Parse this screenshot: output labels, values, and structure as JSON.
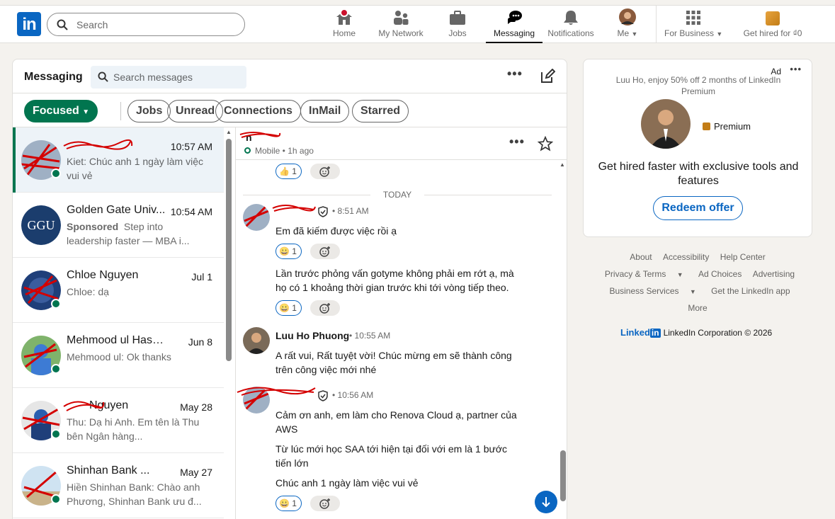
{
  "nav": {
    "search_placeholder": "Search",
    "items": [
      {
        "label": "Home",
        "icon": "home-icon"
      },
      {
        "label": "My Network",
        "icon": "network-icon"
      },
      {
        "label": "Jobs",
        "icon": "briefcase-icon"
      },
      {
        "label": "Messaging",
        "icon": "messaging-icon"
      },
      {
        "label": "Notifications",
        "icon": "bell-icon"
      },
      {
        "label": "Me",
        "icon": "avatar"
      },
      {
        "label": "For Business",
        "icon": "grid-icon"
      },
      {
        "label": "Get hired for ₫0",
        "icon": "premium-icon"
      }
    ]
  },
  "messaging": {
    "title": "Messaging",
    "search_placeholder": "Search messages",
    "filters": [
      "Focused",
      "Jobs",
      "Unread",
      "Connections",
      "InMail",
      "Starred"
    ],
    "conversations": [
      {
        "name": "",
        "time": "10:57 AM",
        "preview": "Kiet: Chúc anh 1 ngày làm việc vui vẻ",
        "online": true,
        "selected": true
      },
      {
        "name": "Golden Gate Univ...",
        "time": "10:54 AM",
        "sponsored": "Sponsored",
        "preview": "Step into leadership faster — MBA i...",
        "online": false
      },
      {
        "name": "Chloe Nguyen",
        "time": "Jul 1",
        "preview": "Chloe: dạ",
        "online": true
      },
      {
        "name": "Mehmood ul Hassan",
        "time": "Jun 8",
        "preview": "Mehmood ul: Ok thanks",
        "online": true
      },
      {
        "name": "Nguyen",
        "time": "May 28",
        "preview": "Thu: Dạ hi Anh. Em tên là Thu bên Ngân hàng...",
        "online": true
      },
      {
        "name": "Shinhan Bank ...",
        "time": "May 27",
        "preview": "Hiền Shinhan Bank: Chào anh Phương, Shinhan Bank ưu đ...",
        "online": true
      }
    ]
  },
  "thread": {
    "name": "n",
    "status": "Mobile • 1h ago",
    "today_label": "TODAY",
    "messages": [
      {
        "sender": "",
        "time": "• 8:51 AM",
        "text": "Em đã kiếm được việc rồi ạ",
        "reaction": "1"
      },
      {
        "text": "Lần trước phỏng vấn gotyme không phải em rớt ạ, mà họ có 1 khoảng thời gian trước khi tới vòng tiếp theo.",
        "reaction": "1"
      },
      {
        "sender": "Luu Ho Phuong",
        "time": "• 10:55 AM",
        "text": "A rất vui, Rất tuyệt vời! Chúc mừng em sẽ thành công trên công việc mới nhé"
      },
      {
        "sender": "",
        "time": "• 10:56 AM",
        "text": "Cảm ơn anh, em làm cho Renova Cloud ạ, partner của AWS"
      },
      {
        "text": "Từ lúc mới học SAA tới hiện tại đối với em là 1 bước tiến lớn"
      },
      {
        "text": "Chúc anh 1 ngày làm việc vui vẻ",
        "reaction": "1"
      }
    ],
    "top_reaction": "1"
  },
  "ad": {
    "label": "Ad",
    "text": "Luu Ho, enjoy 50% off 2 months of LinkedIn Premium",
    "premium": "Premium",
    "headline": "Get hired faster with exclusive tools and features",
    "button": "Redeem offer"
  },
  "footer": {
    "row1": [
      "About",
      "Accessibility",
      "Help Center"
    ],
    "row2": [
      "Privacy & Terms",
      "Ad Choices",
      "Advertising"
    ],
    "row3": [
      "Business Services",
      "Get the LinkedIn app"
    ],
    "more": "More",
    "brand": "Linked",
    "brand_in": "in",
    "copyright": "LinkedIn Corporation © 2026"
  },
  "colors": {
    "brand": "#0a66c2",
    "accent_green": "#01754f",
    "notif_red": "#cb112d"
  }
}
